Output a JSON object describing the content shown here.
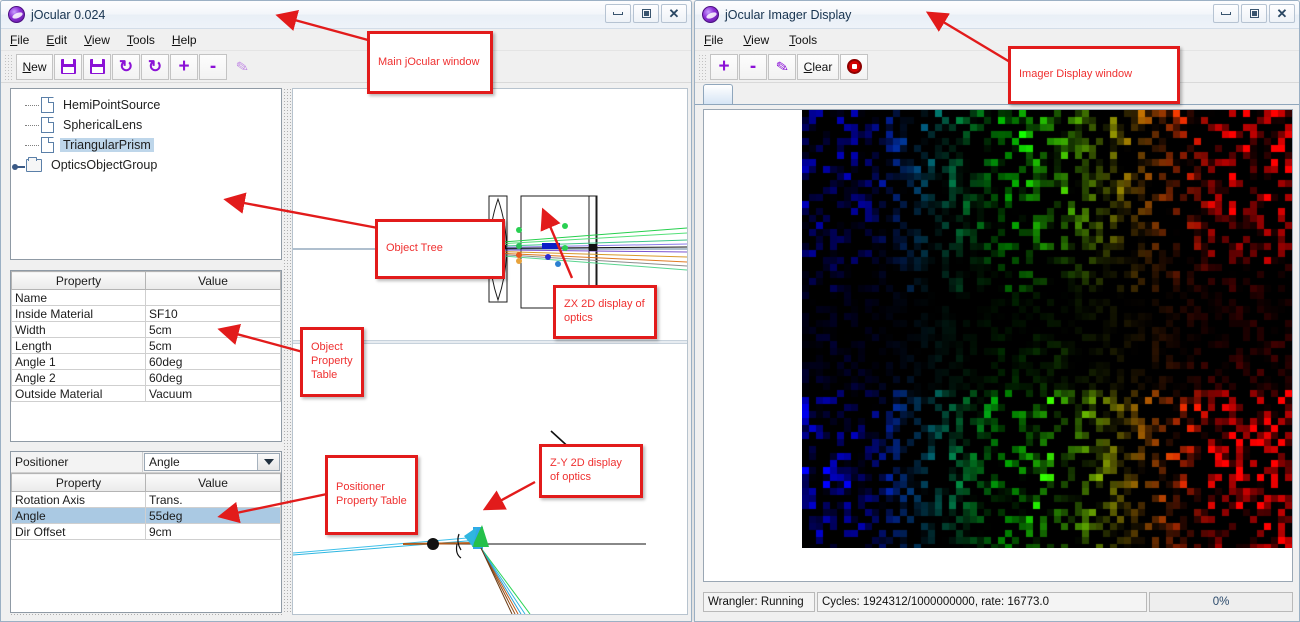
{
  "main_window": {
    "title": "jOcular 0.024",
    "icon": "jocular-logo-icon",
    "window_buttons": {
      "minimize": "minimize-icon",
      "maximize": "maximize-icon",
      "close": "close-icon"
    },
    "menus": [
      "File",
      "Edit",
      "View",
      "Tools",
      "Help"
    ],
    "toolbar": [
      {
        "name": "new-button",
        "label": "New",
        "icon": ""
      },
      {
        "name": "save-button",
        "label": "",
        "icon": "floppy-icon"
      },
      {
        "name": "save-as-button",
        "label": "",
        "icon": "floppy-icon"
      },
      {
        "name": "undo-button",
        "label": "",
        "icon": "undo-arrow-icon"
      },
      {
        "name": "redo-button",
        "label": "",
        "icon": "redo-arrow-icon"
      },
      {
        "name": "add-button",
        "label": "",
        "icon": "plus-icon"
      },
      {
        "name": "remove-button",
        "label": "",
        "icon": "minus-icon"
      },
      {
        "name": "edit-button",
        "label": "",
        "icon": "pencil-icon"
      }
    ],
    "tree": {
      "items": [
        {
          "label": "HemiPointSource",
          "icon": "file-icon",
          "selected": false,
          "expandable": false
        },
        {
          "label": "SphericalLens",
          "icon": "file-icon",
          "selected": false,
          "expandable": false
        },
        {
          "label": "TriangularPrism",
          "icon": "file-icon",
          "selected": true,
          "expandable": false
        },
        {
          "label": "OpticsObjectGroup",
          "icon": "folder-icon",
          "selected": false,
          "expandable": true
        }
      ]
    },
    "object_property_table": {
      "headers": [
        "Property",
        "Value"
      ],
      "rows": [
        {
          "property": "Name",
          "value": ""
        },
        {
          "property": "Inside Material",
          "value": "SF10"
        },
        {
          "property": "Width",
          "value": "5cm"
        },
        {
          "property": "Length",
          "value": "5cm"
        },
        {
          "property": "Angle 1",
          "value": "60deg"
        },
        {
          "property": "Angle 2",
          "value": "60deg"
        },
        {
          "property": "Outside Material",
          "value": "Vacuum"
        }
      ]
    },
    "positioner": {
      "label": "Positioner",
      "selected_value": "Angle",
      "options": [
        "Angle"
      ]
    },
    "positioner_property_table": {
      "headers": [
        "Property",
        "Value"
      ],
      "rows": [
        {
          "property": "Rotation Axis",
          "value": "Trans.",
          "selected": false
        },
        {
          "property": "Angle",
          "value": "55deg",
          "selected": true
        },
        {
          "property": "Dir Offset",
          "value": "9cm",
          "selected": false
        }
      ]
    }
  },
  "imager_window": {
    "title": "jOcular Imager Display",
    "icon": "jocular-logo-icon",
    "window_buttons": {
      "minimize": "minimize-icon",
      "maximize": "maximize-icon",
      "close": "close-icon"
    },
    "menus": [
      "File",
      "View",
      "Tools"
    ],
    "toolbar": [
      {
        "name": "zoom-in-button",
        "label": "",
        "icon": "plus-icon"
      },
      {
        "name": "zoom-out-button",
        "label": "",
        "icon": "minus-icon"
      },
      {
        "name": "edit-button",
        "label": "",
        "icon": "pencil-icon"
      },
      {
        "name": "clear-button",
        "label": "Clear",
        "icon": ""
      },
      {
        "name": "stop-button",
        "label": "",
        "icon": "record-stop-icon"
      }
    ],
    "statusbar": {
      "wrangler": "Wrangler: Running",
      "cycles": "Cycles: 1924312/1000000000, rate: 16773.0",
      "progress_label": "0%",
      "progress_value": 0
    }
  },
  "annotations": [
    {
      "name": "callout-main-window",
      "text": "Main jOcular window"
    },
    {
      "name": "callout-imager-window",
      "text": "Imager Display window"
    },
    {
      "name": "callout-object-tree",
      "text": "Object Tree"
    },
    {
      "name": "callout-object-property-table",
      "text": "Object\nProperty\nTable"
    },
    {
      "name": "callout-zx-display",
      "text": "ZX 2D display of optics"
    },
    {
      "name": "callout-zy-display",
      "text": "Z-Y 2D display of optics"
    },
    {
      "name": "callout-positioner-property-table",
      "text": "Positioner\nProperty Table"
    }
  ],
  "colors": {
    "annotation_border": "#e21b1b",
    "annotation_text": "#ef3030",
    "accent_purple": "#8b12d6",
    "selection_blue": "#aac9e3",
    "title_text": "#17334f"
  }
}
